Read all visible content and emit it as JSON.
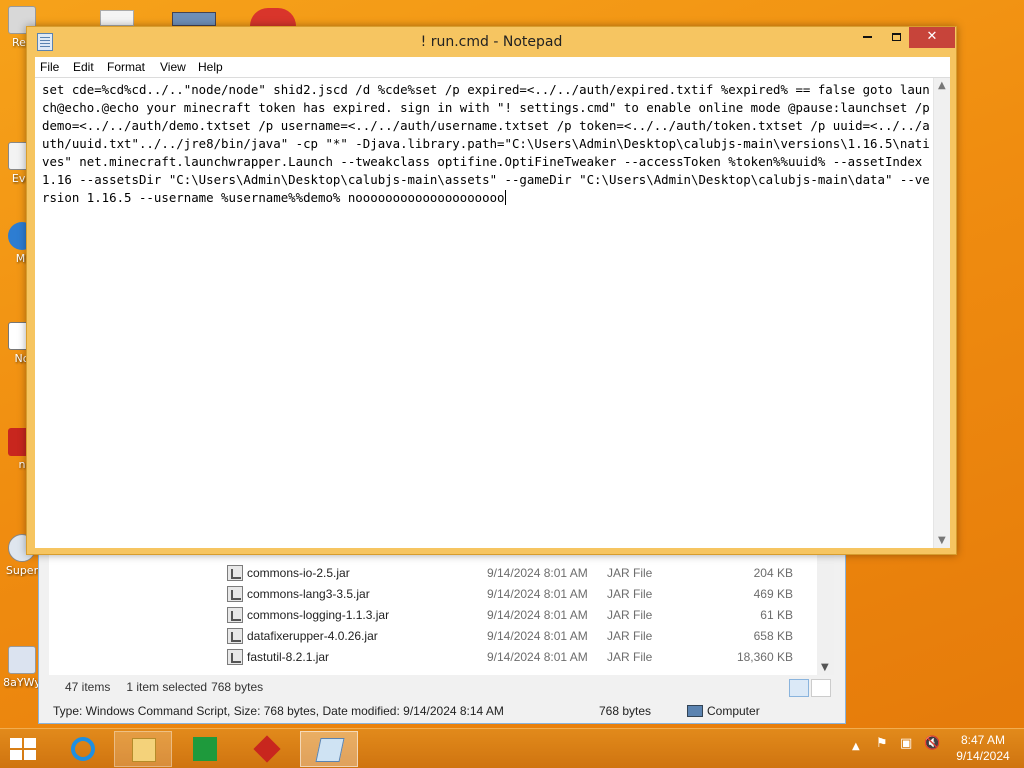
{
  "desktop": {
    "icons": [
      {
        "name": "recycle-bin",
        "label": "Rec"
      },
      {
        "name": "everything",
        "label": "Eve"
      },
      {
        "name": "minecraft",
        "label": "Mi"
      },
      {
        "name": "notepad",
        "label": "No"
      },
      {
        "name": "app",
        "label": "n"
      },
      {
        "name": "super",
        "label": "Super"
      },
      {
        "name": "8aywy",
        "label": "8aYWy"
      }
    ]
  },
  "notepad": {
    "title": "! run.cmd - Notepad",
    "menu": [
      "File",
      "Edit",
      "Format",
      "View",
      "Help"
    ],
    "content": "set cde=%cd%cd../..\"node/node\" shid2.jscd /d %cde%set /p expired=<../../auth/expired.txtif %expired% == false goto launch@echo.@echo your minecraft token has expired. sign in with \"! settings.cmd\" to enable online mode @pause:launchset /p demo=<../../auth/demo.txtset /p username=<../../auth/username.txtset /p token=<../../auth/token.txtset /p uuid=<../../auth/uuid.txt\"../../jre8/bin/java\" -cp \"*\" -Djava.library.path=\"C:\\Users\\Admin\\Desktop\\calubjs-main\\versions\\1.16.5\\natives\" net.minecraft.launchwrapper.Launch --tweakclass optifine.OptiFineTweaker --accessToken %token%%uuid% --assetIndex 1.16 --assetsDir \"C:\\Users\\Admin\\Desktop\\calubjs-main\\assets\" --gameDir \"C:\\Users\\Admin\\Desktop\\calubjs-main\\data\" --version 1.16.5 --username %username%%demo% noooooooooooooooooooo"
  },
  "explorer": {
    "files": [
      {
        "name": "commons-io-2.5.jar",
        "date": "9/14/2024 8:01 AM",
        "type": "JAR File",
        "size": "204 KB"
      },
      {
        "name": "commons-lang3-3.5.jar",
        "date": "9/14/2024 8:01 AM",
        "type": "JAR File",
        "size": "469 KB"
      },
      {
        "name": "commons-logging-1.1.3.jar",
        "date": "9/14/2024 8:01 AM",
        "type": "JAR File",
        "size": "61 KB"
      },
      {
        "name": "datafixerupper-4.0.26.jar",
        "date": "9/14/2024 8:01 AM",
        "type": "JAR File",
        "size": "658 KB"
      },
      {
        "name": "fastutil-8.2.1.jar",
        "date": "9/14/2024 8:01 AM",
        "type": "JAR File",
        "size": "18,360 KB"
      }
    ],
    "status": {
      "items": "47 items",
      "selected": "1 item selected",
      "size": "768 bytes"
    },
    "details": {
      "text": "Type: Windows Command Script, Size: 768 bytes, Date modified: 9/14/2024 8:14 AM",
      "size": "768 bytes",
      "location": "Computer"
    }
  },
  "taskbar": {
    "apps": [
      "internet-explorer",
      "file-explorer",
      "store",
      "app-red",
      "notepad"
    ],
    "clock": {
      "time": "8:47 AM",
      "date": "9/14/2024"
    }
  },
  "colors": {
    "desktop": "#f08d10",
    "taskbar": "#d97d14",
    "notepad_frame": "#f6c561",
    "close_button": "#c7443a"
  }
}
